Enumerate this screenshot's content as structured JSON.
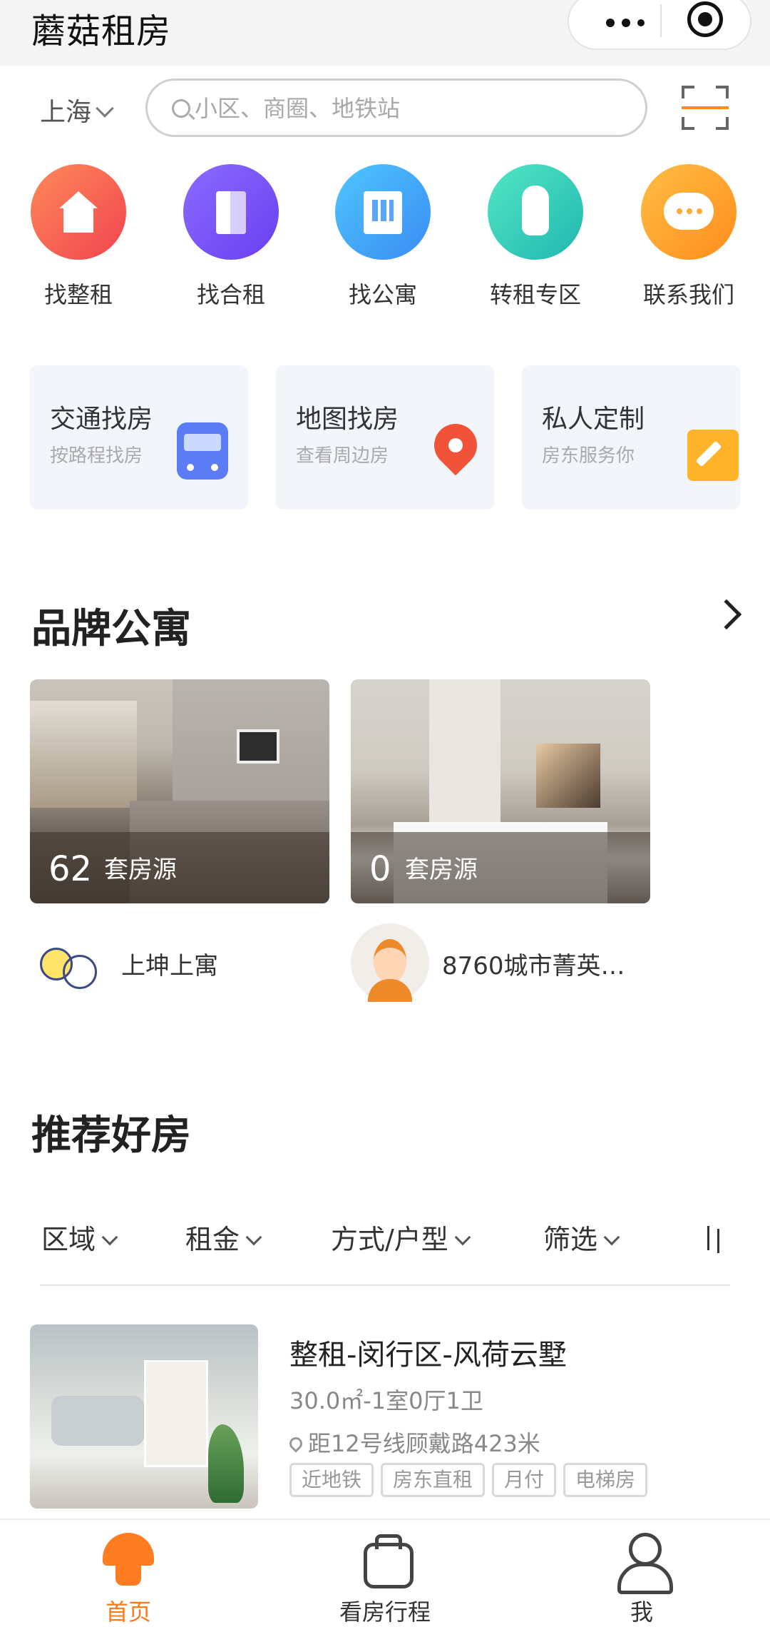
{
  "app": {
    "title": "蘑菇租房"
  },
  "header": {
    "city": "上海",
    "search_placeholder": "小区、商圈、地铁站"
  },
  "quick_nav": [
    {
      "label": "找整租",
      "icon": "house-icon"
    },
    {
      "label": "找合租",
      "icon": "door-icon"
    },
    {
      "label": "找公寓",
      "icon": "building-icon"
    },
    {
      "label": "转租专区",
      "icon": "hand-tap-icon"
    },
    {
      "label": "联系我们",
      "icon": "chat-bubble-icon"
    }
  ],
  "feature_cards": [
    {
      "title": "交通找房",
      "subtitle": "按路程找房",
      "icon": "train-icon"
    },
    {
      "title": "地图找房",
      "subtitle": "查看周边房",
      "icon": "map-pin-icon"
    },
    {
      "title": "私人定制",
      "subtitle": "房东服务你",
      "icon": "custom-tag-icon"
    }
  ],
  "brand_section": {
    "title": "品牌公寓",
    "items": [
      {
        "count": "62",
        "count_label": "套房源",
        "name": "上坤上寓"
      },
      {
        "count": "0",
        "count_label": "套房源",
        "name": "8760城市菁英…"
      }
    ]
  },
  "recommend_section": {
    "title": "推荐好房",
    "filters": [
      "区域",
      "租金",
      "方式/户型",
      "筛选"
    ],
    "listings": [
      {
        "title": "整租-闵行区-风荷云墅",
        "spec": "30.0㎡-1室0厅1卫",
        "location": "距12号线顾戴路423米",
        "tags": [
          "近地铁",
          "房东直租",
          "月付",
          "电梯房"
        ]
      }
    ]
  },
  "tabbar": {
    "items": [
      {
        "label": "首页",
        "icon": "mushroom-home-icon",
        "active": true
      },
      {
        "label": "看房行程",
        "icon": "suitcase-icon",
        "active": false
      },
      {
        "label": "我",
        "icon": "user-icon",
        "active": false
      }
    ]
  },
  "colors": {
    "accent": "#ff7a1a",
    "text": "#333333",
    "muted": "#999999",
    "card_bg": "#f2f5fa"
  }
}
